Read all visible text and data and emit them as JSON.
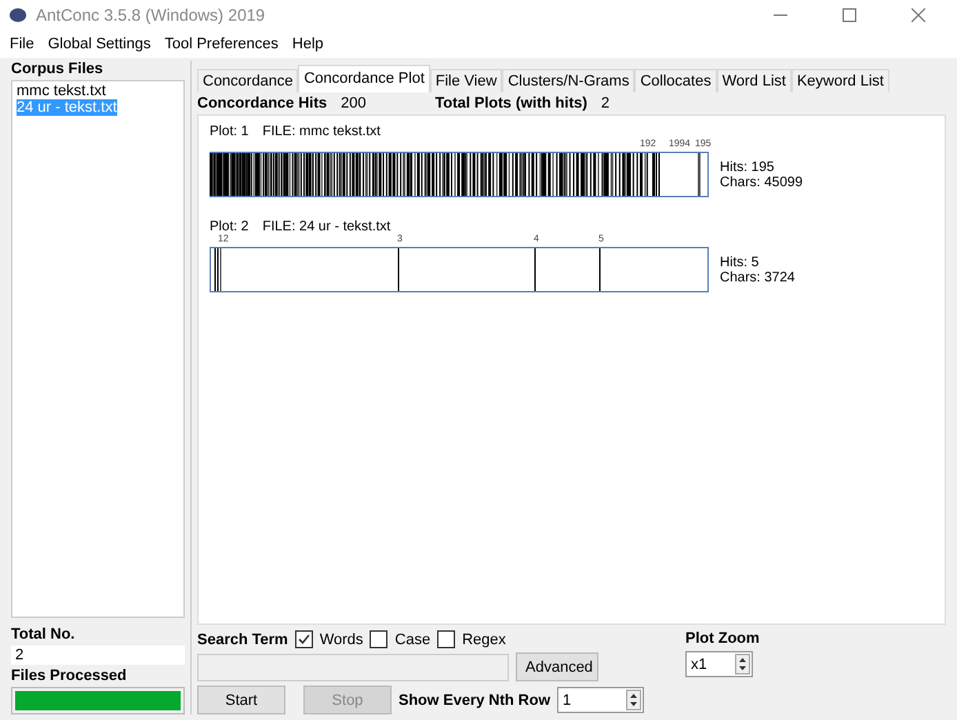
{
  "window": {
    "title": "AntConc 3.5.8 (Windows) 2019"
  },
  "menu": [
    "File",
    "Global Settings",
    "Tool Preferences",
    "Help"
  ],
  "corpus_files": {
    "title": "Corpus Files",
    "items": [
      {
        "label": "mmc tekst.txt",
        "selected": false
      },
      {
        "label": "24 ur - tekst.txt",
        "selected": true
      }
    ]
  },
  "totals": {
    "total_label": "Total No.",
    "total_value": "2",
    "processed_label": "Files Processed",
    "level": 1
  },
  "tabs": [
    {
      "label": "Concordance",
      "selected": false
    },
    {
      "label": "Concordance Plot",
      "selected": true
    },
    {
      "label": "File View",
      "selected": false
    },
    {
      "label": "Clusters/N-Grams",
      "selected": false
    },
    {
      "label": "Collocates",
      "selected": false
    },
    {
      "label": "Word List",
      "selected": false
    },
    {
      "label": "Keyword List",
      "selected": false
    }
  ],
  "summary": {
    "hits_label": "Concordance Hits",
    "hits": "200",
    "plots_label": "Total Plots (with hits)",
    "plots": "2"
  },
  "plots": [
    {
      "plot": "Plot: 1",
      "file": "FILE: mmc tekst.txt",
      "ticks": [
        "192",
        "1994",
        "195"
      ],
      "hits": "Hits: 195",
      "chars": "Chars: 45099"
    },
    {
      "plot": "Plot: 2",
      "file": "FILE: 24 ur - tekst.txt",
      "ticks": [
        "12",
        "3",
        "4",
        "5"
      ],
      "hits": "Hits: 5",
      "chars": "Chars: 3724"
    }
  ],
  "search": {
    "label": "Search Term",
    "options": [
      {
        "label": "Words",
        "checked": true
      },
      {
        "label": "Case",
        "checked": false
      },
      {
        "label": "Regex",
        "checked": false
      }
    ],
    "advanced": "Advanced",
    "start": "Start",
    "stop": "Stop",
    "stop_disabled": true,
    "nth_label": "Show Every Nth Row",
    "nth_value": "1"
  },
  "zoom": {
    "label": "Plot Zoom",
    "value": "x1"
  }
}
